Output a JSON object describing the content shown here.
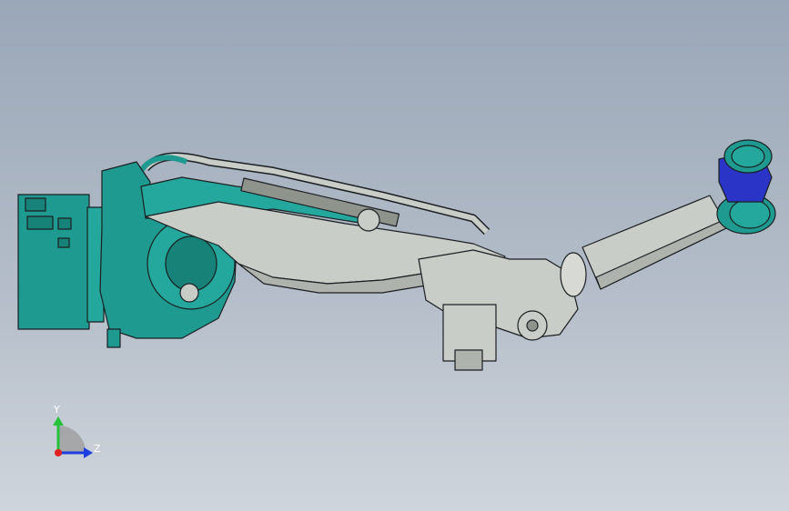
{
  "viewport": {
    "background_top": "#9aa7b8",
    "background_bottom": "#cfd5dc"
  },
  "model": {
    "base_color": "#1f9a90",
    "arm_color": "#c9cdc7",
    "wrist_color": "#2a35c8",
    "edge_color": "#1b1f22"
  },
  "triad": {
    "y_label": "Y",
    "z_label": "Z",
    "y_color": "#25c23a",
    "z_color": "#1d3fe0",
    "x_color": "#e02020"
  }
}
